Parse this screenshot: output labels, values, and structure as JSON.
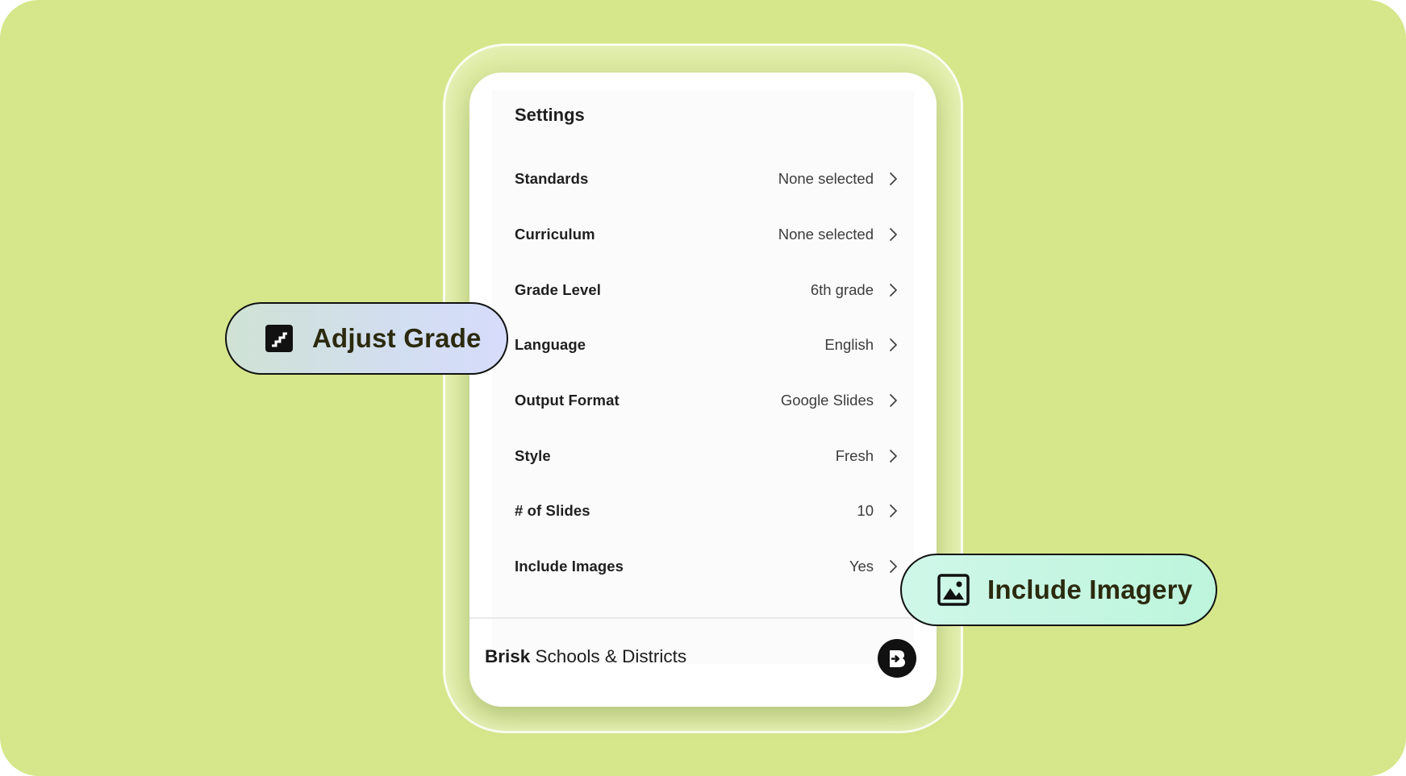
{
  "settings": {
    "title": "Settings",
    "rows": [
      {
        "label": "Standards",
        "value": "None selected"
      },
      {
        "label": "Curriculum",
        "value": "None selected"
      },
      {
        "label": "Grade Level",
        "value": "6th grade"
      },
      {
        "label": "Language",
        "value": "English"
      },
      {
        "label": "Output Format",
        "value": "Google Slides"
      },
      {
        "label": "Style",
        "value": "Fresh"
      },
      {
        "label": "# of Slides",
        "value": "10"
      },
      {
        "label": "Include Images",
        "value": "Yes"
      }
    ]
  },
  "footer": {
    "brand": "Brisk",
    "subtitle": " Schools & Districts",
    "logo_icon": "brisk-logo-icon"
  },
  "callouts": {
    "adjust_grade": {
      "label": "Adjust Grade",
      "icon": "stairs-icon"
    },
    "include_imagery": {
      "label": "Include Imagery",
      "icon": "image-icon"
    }
  },
  "colors": {
    "background": "#d5e78a",
    "card": "#ffffff",
    "text": "#1f1f1f"
  }
}
